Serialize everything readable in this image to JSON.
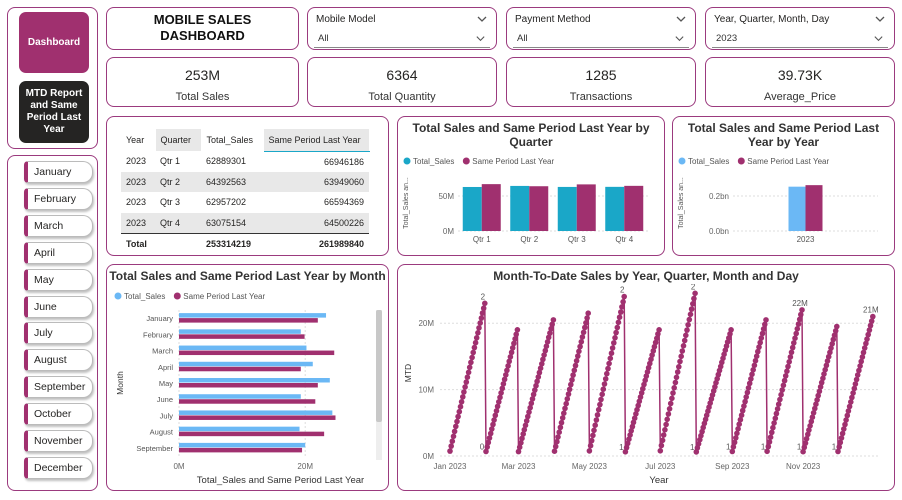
{
  "colors": {
    "accent": "#9b3a7e",
    "total_sales": "#1aa7c8",
    "same_period": "#a0306f",
    "total_sales_light": "#6bb8f5",
    "dashboard_btn": "#a0306f",
    "mtd_btn": "#252423"
  },
  "nav": {
    "dashboard_label": "Dashboard",
    "mtd_label": "MTD Report and Same Period Last Year"
  },
  "months": [
    "January",
    "February",
    "March",
    "April",
    "May",
    "June",
    "July",
    "August",
    "September",
    "October",
    "November",
    "December"
  ],
  "header": {
    "title": "MOBILE SALES DASHBOARD"
  },
  "slicers": {
    "model": {
      "title": "Mobile Model",
      "value": "All"
    },
    "payment": {
      "title": "Payment Method",
      "value": "All"
    },
    "date": {
      "title": "Year, Quarter, Month, Day",
      "value": "2023"
    }
  },
  "kpis": {
    "total_sales": {
      "value": "253M",
      "label": "Total Sales"
    },
    "total_quantity": {
      "value": "6364",
      "label": "Total Quantity"
    },
    "transactions": {
      "value": "1285",
      "label": "Transactions"
    },
    "average_price": {
      "value": "39.73K",
      "label": "Average_Price"
    }
  },
  "table": {
    "columns": [
      "Year",
      "Quarter",
      "Total_Sales",
      "Same Period Last Year"
    ],
    "rows": [
      [
        "2023",
        "Qtr 1",
        "62889301",
        "66946186"
      ],
      [
        "2023",
        "Qtr 2",
        "64392563",
        "63949060"
      ],
      [
        "2023",
        "Qtr 3",
        "62957202",
        "66594369"
      ],
      [
        "2023",
        "Qtr 4",
        "63075154",
        "64500226"
      ]
    ],
    "total": [
      "Total",
      "",
      "253314219",
      "261989840"
    ]
  },
  "chart_data": [
    {
      "id": "by_quarter",
      "type": "bar",
      "title": "Total Sales and Same Period Last Year by Quarter",
      "ylabel": "Total_Sales an...",
      "categories": [
        "Qtr 1",
        "Qtr 2",
        "Qtr 3",
        "Qtr 4"
      ],
      "yticks": [
        "0M",
        "50M"
      ],
      "ylim": [
        0,
        80000000
      ],
      "legend": "top-left",
      "series": [
        {
          "name": "Total_Sales",
          "values": [
            62889301,
            64392563,
            62957202,
            63075154
          ]
        },
        {
          "name": "Same Period Last Year",
          "values": [
            66946186,
            63949060,
            66594369,
            64500226
          ]
        }
      ]
    },
    {
      "id": "by_year",
      "type": "bar",
      "title": "Total Sales and Same Period Last Year by Year",
      "ylabel": "Total_Sales an...",
      "categories": [
        "2023"
      ],
      "yticks": [
        "0.0bn",
        "0.2bn"
      ],
      "ylim": [
        0,
        0.32
      ],
      "legend": "top-left",
      "series": [
        {
          "name": "Total_Sales",
          "values": [
            0.2533
          ]
        },
        {
          "name": "Same Period Last Year",
          "values": [
            0.262
          ]
        }
      ]
    },
    {
      "id": "by_month",
      "type": "bar",
      "orientation": "horizontal",
      "title": "Total Sales and Same Period Last Year by Month",
      "xlabel": "Total_Sales and Same Period Last Year",
      "ylabel": "Month",
      "xticks": [
        "0M",
        "20M"
      ],
      "xlim": [
        0,
        29000000
      ],
      "legend": "top-left",
      "categories": [
        "January",
        "February",
        "March",
        "April",
        "May",
        "June",
        "July",
        "August",
        "September"
      ],
      "series": [
        {
          "name": "Total_Sales",
          "values": [
            23300000,
            19300000,
            20200000,
            21200000,
            23900000,
            19300000,
            24300000,
            19100000,
            20000000
          ]
        },
        {
          "name": "Same Period Last Year",
          "values": [
            22000000,
            19900000,
            24600000,
            19300000,
            22000000,
            21600000,
            24800000,
            23000000,
            19500000
          ]
        }
      ]
    },
    {
      "id": "mtd",
      "type": "line",
      "title": "Month-To-Date Sales by Year, Quarter, Month and Day",
      "xlabel": "Year",
      "ylabel": "MTD",
      "yticks": [
        "0M",
        "10M",
        "20M"
      ],
      "ylim": [
        0,
        25000000
      ],
      "xticks": [
        "Jan 2023",
        "Mar 2023",
        "May 2023",
        "Jul 2023",
        "Sep 2023",
        "Nov 2023"
      ],
      "month_peaks": [
        23000000,
        19000000,
        20500000,
        21500000,
        24000000,
        19000000,
        24500000,
        19000000,
        20500000,
        22000000,
        19500000,
        21000000
      ],
      "peak_labels": [
        {
          "month": 1,
          "text": "2"
        },
        {
          "month": 5,
          "text": "2"
        },
        {
          "month": 7,
          "text": "2"
        },
        {
          "month": 10,
          "text": "22M"
        },
        {
          "month": 12,
          "text": "21M"
        }
      ],
      "start_labels": [
        {
          "month": 2,
          "text": "0"
        },
        {
          "month": 6,
          "text": "1"
        },
        {
          "month": 8,
          "text": "1"
        },
        {
          "month": 9,
          "text": "1"
        },
        {
          "month": 10,
          "text": "1"
        },
        {
          "month": 11,
          "text": "1"
        },
        {
          "month": 12,
          "text": "1"
        }
      ]
    }
  ]
}
